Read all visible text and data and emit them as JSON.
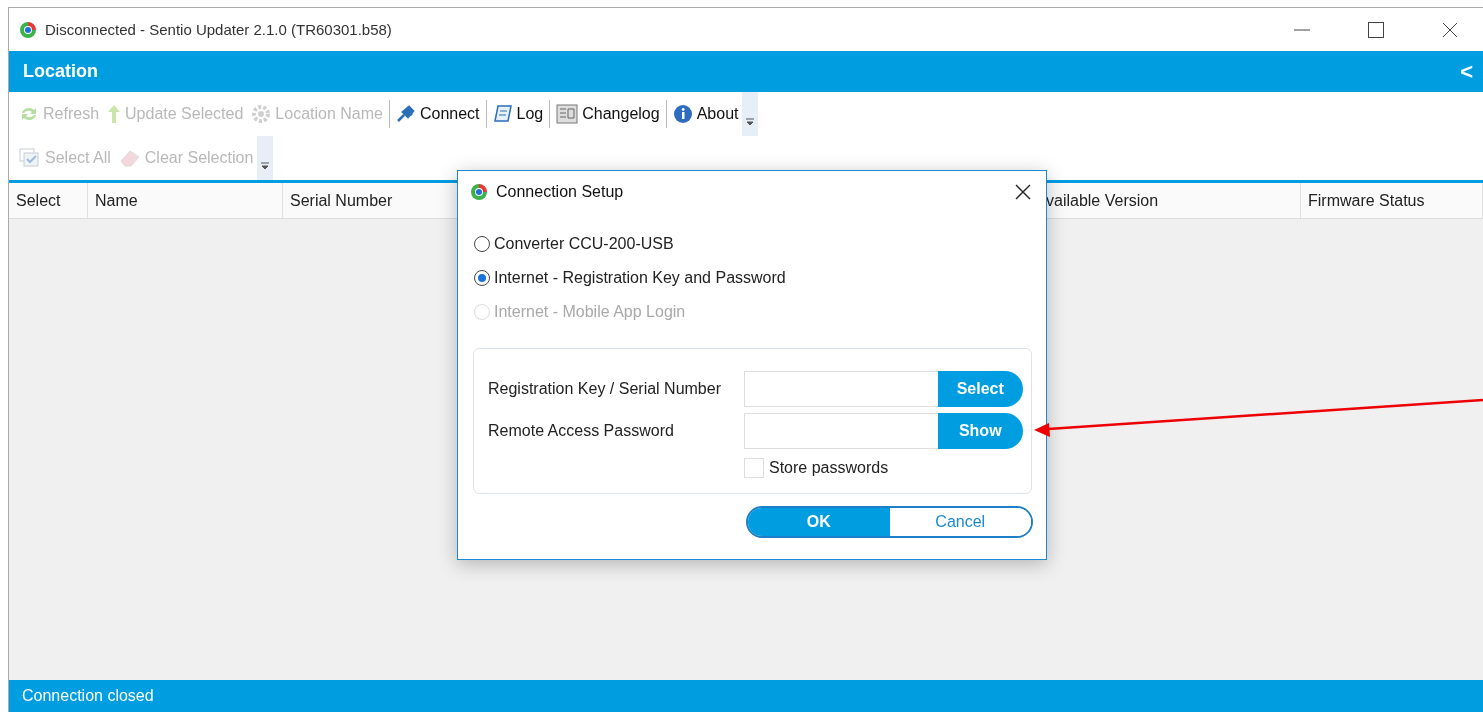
{
  "window": {
    "title": "Disconnected - Sentio Updater 2.1.0 (TR60301.b58)"
  },
  "location_bar": {
    "title": "Location",
    "collapse": "<"
  },
  "toolbar": {
    "rows": [
      {
        "items": [
          {
            "kind": "refresh",
            "label": "Refresh",
            "disabled": true
          },
          {
            "kind": "update",
            "label": "Update Selected",
            "disabled": true
          },
          {
            "kind": "gear",
            "label": "Location Name",
            "disabled": true
          },
          {
            "kind": "separator"
          },
          {
            "kind": "connect",
            "label": "Connect",
            "disabled": false
          },
          {
            "kind": "separator"
          },
          {
            "kind": "log",
            "label": "Log",
            "disabled": false
          },
          {
            "kind": "separator"
          },
          {
            "kind": "changelog",
            "label": "Changelog",
            "disabled": false
          },
          {
            "kind": "separator"
          },
          {
            "kind": "about",
            "label": "About",
            "disabled": false
          },
          {
            "kind": "overflow"
          }
        ]
      },
      {
        "items": [
          {
            "kind": "selectall",
            "label": "Select All",
            "disabled": true
          },
          {
            "kind": "eraser",
            "label": "Clear Selection",
            "disabled": true
          },
          {
            "kind": "overflow"
          }
        ]
      }
    ]
  },
  "table": {
    "columns": [
      "Select",
      "Name",
      "Serial Number",
      "vailable Version",
      "Firmware Status"
    ]
  },
  "status_bar": {
    "text": "Connection closed"
  },
  "dialog": {
    "title": "Connection Setup",
    "options": [
      {
        "label": "Converter CCU-200-USB",
        "selected": false,
        "disabled": false
      },
      {
        "label": "Internet - Registration Key and Password",
        "selected": true,
        "disabled": false
      },
      {
        "label": "Internet - Mobile App Login",
        "selected": false,
        "disabled": true
      }
    ],
    "fields": [
      {
        "label": "Registration Key / Serial Number",
        "button": "Select"
      },
      {
        "label": "Remote Access Password",
        "button": "Show"
      }
    ],
    "store_passwords": {
      "label": "Store passwords",
      "checked": false
    },
    "buttons": [
      {
        "label": "OK",
        "kind": "primary"
      },
      {
        "label": "Cancel",
        "kind": "secondary"
      }
    ]
  }
}
